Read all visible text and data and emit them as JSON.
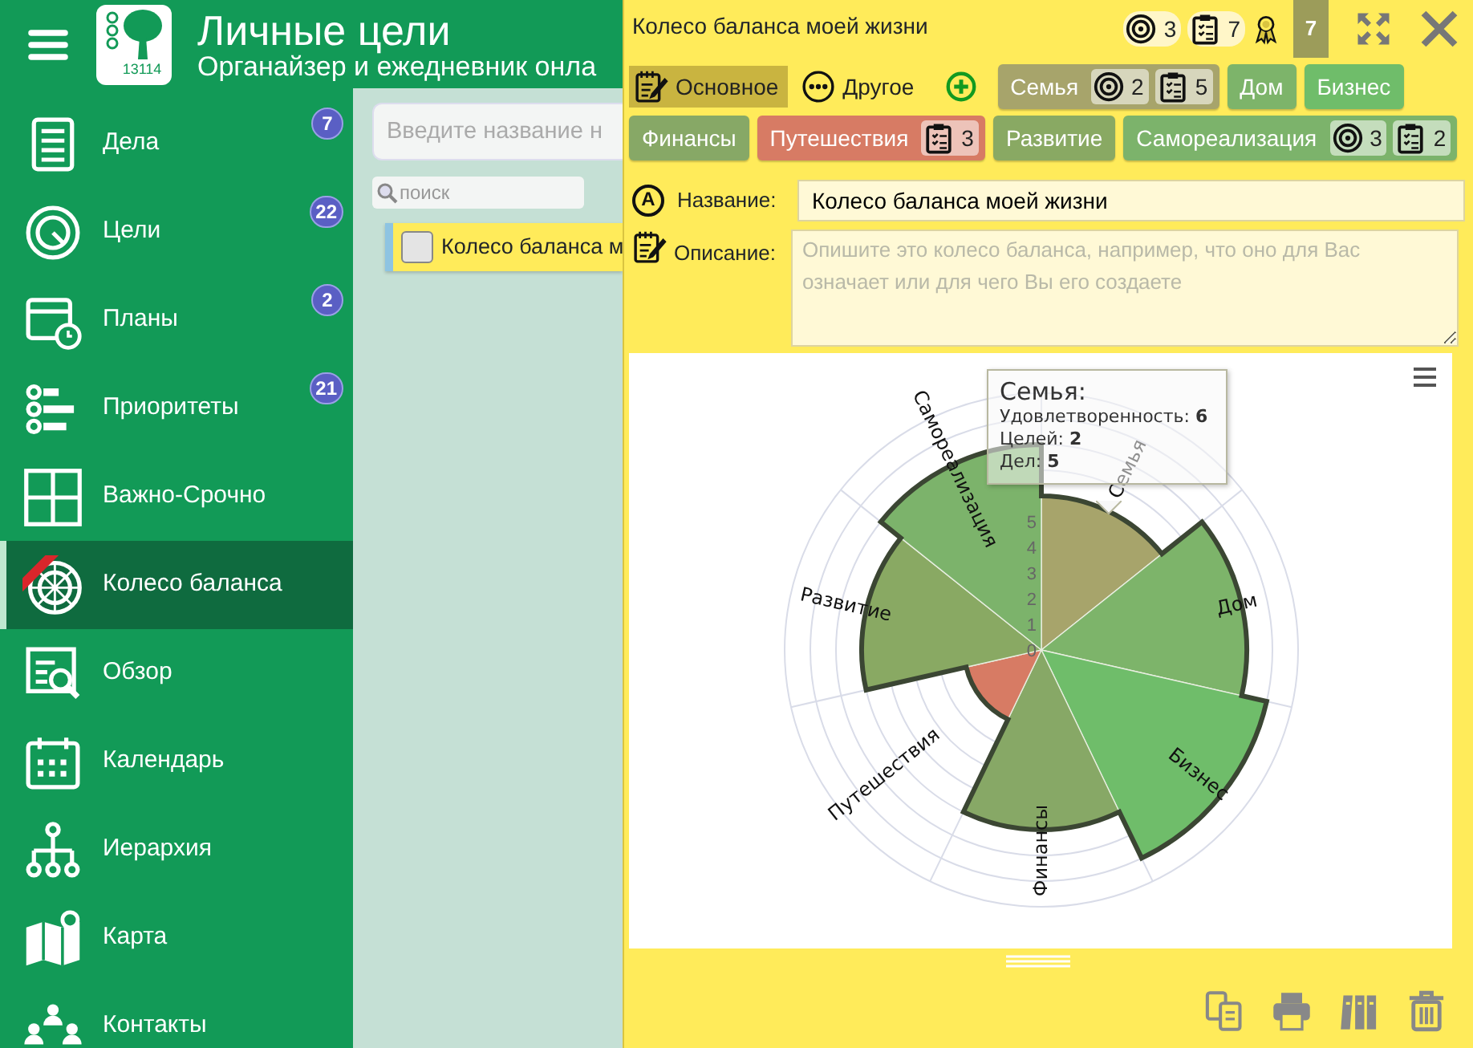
{
  "header": {
    "title": "Личные цели",
    "subtitle": "Органайзер и ежедневник онла",
    "logo_number": "13114"
  },
  "sidebar": {
    "items": [
      {
        "label": "Дела",
        "count": "7",
        "selected": false
      },
      {
        "label": "Цели",
        "count": "22",
        "selected": false
      },
      {
        "label": "Планы",
        "count": "2",
        "selected": false
      },
      {
        "label": "Приоритеты",
        "count": "21",
        "selected": false
      },
      {
        "label": "Важно-Срочно",
        "selected": false
      },
      {
        "label": "Колесо баланса",
        "selected": true
      },
      {
        "label": "Обзор",
        "selected": false
      },
      {
        "label": "Календарь",
        "selected": false
      },
      {
        "label": "Иерархия",
        "selected": false
      },
      {
        "label": "Карта",
        "selected": false
      },
      {
        "label": "Контакты",
        "selected": false
      }
    ]
  },
  "list_panel": {
    "new_item": {
      "placeholder": "Введите название н"
    },
    "search": {
      "placeholder": "поиск"
    },
    "items": [
      {
        "title": "Колесо баланса м",
        "checked": false
      }
    ]
  },
  "editor": {
    "title": "Колесо баланса моей жизни",
    "goals": "3",
    "tasks": "7",
    "score": "7",
    "tabs": [
      {
        "label": "Основное",
        "selected": true
      },
      {
        "label": "Другое",
        "selected": false
      }
    ],
    "categories": [
      {
        "name": "Семья",
        "color": "#a7a46b",
        "goals": "2",
        "tasks": "5"
      },
      {
        "name": "Дом",
        "color": "#7db46a"
      },
      {
        "name": "Бизнес",
        "color": "#6fbd6a"
      },
      {
        "name": "Финансы",
        "color": "#87a866"
      },
      {
        "name": "Путешествия",
        "color": "#d77b64",
        "tasks": "3"
      },
      {
        "name": "Развитие",
        "color": "#89a963"
      },
      {
        "name": "Самореализация",
        "color": "#7cb36b",
        "goals": "3",
        "tasks": "2"
      }
    ],
    "name_field": {
      "icon": "A",
      "label": "Название:",
      "value": "Колесо баланса моей жизни"
    },
    "description_field": {
      "label": "Описание:",
      "placeholder": "Опишите это колесо баланса, например, что оно для Вас означает или для чего Вы его создаете"
    },
    "wheel": {
      "ticks": [
        "5",
        "4",
        "3",
        "2",
        "1",
        "0"
      ],
      "sectors": [
        {
          "label": "Семья",
          "level": 0.6
        },
        {
          "label": "Дом",
          "level": 0.8
        },
        {
          "label": "Бизнес",
          "level": 0.9
        },
        {
          "label": "Финансы",
          "level": 0.7
        },
        {
          "label": "Путешествия",
          "level": 0.3
        },
        {
          "label": "Развитие",
          "level": 0.7
        },
        {
          "label": "Самореализация",
          "level": 0.8
        }
      ],
      "tooltip": {
        "title": "Семья:",
        "lines": [
          "Удовлетворенность: **6**",
          "Целей: **2**",
          "Дел: **5**"
        ]
      }
    }
  }
}
